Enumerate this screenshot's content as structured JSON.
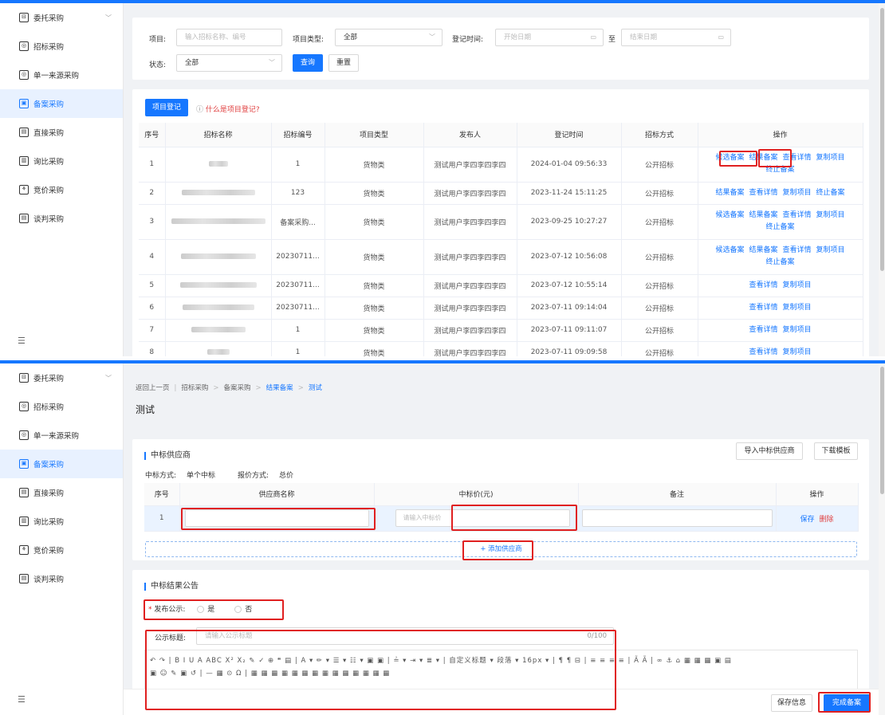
{
  "sidebar": {
    "items": [
      {
        "label": "委托采购",
        "icon": "commission-icon",
        "has_chevron": true
      },
      {
        "label": "招标采购",
        "icon": "tender-icon"
      },
      {
        "label": "单一来源采购",
        "icon": "single-source-icon"
      },
      {
        "label": "备案采购",
        "icon": "filing-icon",
        "active": true
      },
      {
        "label": "直接采购",
        "icon": "direct-icon"
      },
      {
        "label": "询比采购",
        "icon": "inquiry-icon"
      },
      {
        "label": "竞价采购",
        "icon": "bidding-icon"
      },
      {
        "label": "谈判采购",
        "icon": "negotiation-icon"
      }
    ]
  },
  "colors": {
    "accent": "#1677ff",
    "highlight": "#e02020",
    "active_bg": "#e8f1ff"
  },
  "screen1": {
    "filter": {
      "project_label": "项目:",
      "project_placeholder": "输入招标名称、编号",
      "type_label": "项目类型:",
      "type_value": "全部",
      "date_label": "登记时间:",
      "start_placeholder": "开始日期",
      "to_label": "至",
      "end_placeholder": "结束日期",
      "status_label": "状态:",
      "status_value": "全部",
      "search_button": "查询",
      "reset_button": "重置"
    },
    "register_button": "项目登记",
    "help_link": "什么是项目登记?",
    "columns": [
      "序号",
      "招标名称",
      "招标编号",
      "项目类型",
      "发布人",
      "登记时间",
      "招标方式",
      "操作"
    ],
    "rows": [
      {
        "no": "1",
        "code": "1",
        "type": "货物类",
        "publisher": "测试用户李四李四李四",
        "time": "2024-01-04 09:56:33",
        "method": "公开招标",
        "ops": [
          "候选备案",
          "结果备案",
          "查看详情",
          "复制项目",
          "终止备案"
        ]
      },
      {
        "no": "2",
        "code": "123",
        "type": "货物类",
        "publisher": "测试用户李四李四李四",
        "time": "2023-11-24 15:11:25",
        "method": "公开招标",
        "ops": [
          "结果备案",
          "查看详情",
          "复制项目",
          "终止备案"
        ]
      },
      {
        "no": "3",
        "code": "备案采购...",
        "type": "货物类",
        "publisher": "测试用户李四李四李四",
        "time": "2023-09-25 10:27:27",
        "method": "公开招标",
        "ops": [
          "候选备案",
          "结果备案",
          "查看详情",
          "复制项目",
          "终止备案"
        ]
      },
      {
        "no": "4",
        "code": "20230711...",
        "type": "货物类",
        "publisher": "测试用户李四李四李四",
        "time": "2023-07-12 10:56:08",
        "method": "公开招标",
        "ops": [
          "候选备案",
          "结果备案",
          "查看详情",
          "复制项目",
          "终止备案"
        ]
      },
      {
        "no": "5",
        "code": "20230711...",
        "type": "货物类",
        "publisher": "测试用户李四李四李四",
        "time": "2023-07-12 10:55:14",
        "method": "公开招标",
        "ops": [
          "查看详情",
          "复制项目"
        ]
      },
      {
        "no": "6",
        "code": "20230711...",
        "type": "货物类",
        "publisher": "测试用户李四李四李四",
        "time": "2023-07-11 09:14:04",
        "method": "公开招标",
        "ops": [
          "查看详情",
          "复制项目"
        ]
      },
      {
        "no": "7",
        "code": "1",
        "type": "货物类",
        "publisher": "测试用户李四李四李四",
        "time": "2023-07-11 09:11:07",
        "method": "公开招标",
        "ops": [
          "查看详情",
          "复制项目"
        ]
      },
      {
        "no": "8",
        "code": "1",
        "type": "货物类",
        "publisher": "测试用户李四李四李四",
        "time": "2023-07-11 09:09:58",
        "method": "公开招标",
        "ops": [
          "查看详情",
          "复制项目"
        ]
      }
    ]
  },
  "screen2": {
    "breadcrumb": [
      "返回上一页",
      "招标采购",
      "备案采购",
      "结果备案",
      "测试"
    ],
    "page_title": "测试",
    "winner_section": {
      "title": "中标供应商",
      "import_button": "导入中标供应商",
      "download_button": "下载模板",
      "award_method_label": "中标方式:",
      "award_method_value": "单个中标",
      "quote_method_label": "报价方式:",
      "quote_method_value": "总价",
      "columns": [
        "序号",
        "供应商名称",
        "中标价(元)",
        "备注",
        "操作"
      ],
      "row_no": "1",
      "price_placeholder": "请输入中标价",
      "save_link": "保存",
      "delete_link": "删除",
      "add_supplier": "+ 添加供应商"
    },
    "announcement_section": {
      "title": "中标结果公告",
      "publish_label": "发布公示:",
      "yes": "是",
      "no": "否",
      "title_label": "公示标题:",
      "title_placeholder": "请输入公示标题",
      "counter": "0/100",
      "toolbar_row1": "↶ ↷ | B I U A ABC X² X₂ ✎ ✓ ⊕ ❝ ▤ | A ▾ ✏ ▾ ☰ ▾ ☷ ▾ ▣ ▣ | ≟ ▾ ⇥ ▾ ≣ ▾ | 自定义标题 ▾ 段落 ▾ 16px ▾ | ¶ ¶ ⊟ | ≡ ≡ ≡ ≡ | Ã Ã | ∞ ⚓ ⌂ ▦ ▦ ▦ ▣ ▤",
      "toolbar_row2": "▣ ☺ ✎ ▣ ↺ | — ▦ ⊙ Ω | ▦ ▦ ▦ ▦ ▦ ▦ ▦ ▦ ▦ ▦ ▦ ▦ ▦ ▦"
    },
    "save_info_button": "保存信息",
    "complete_button": "完成备案"
  }
}
